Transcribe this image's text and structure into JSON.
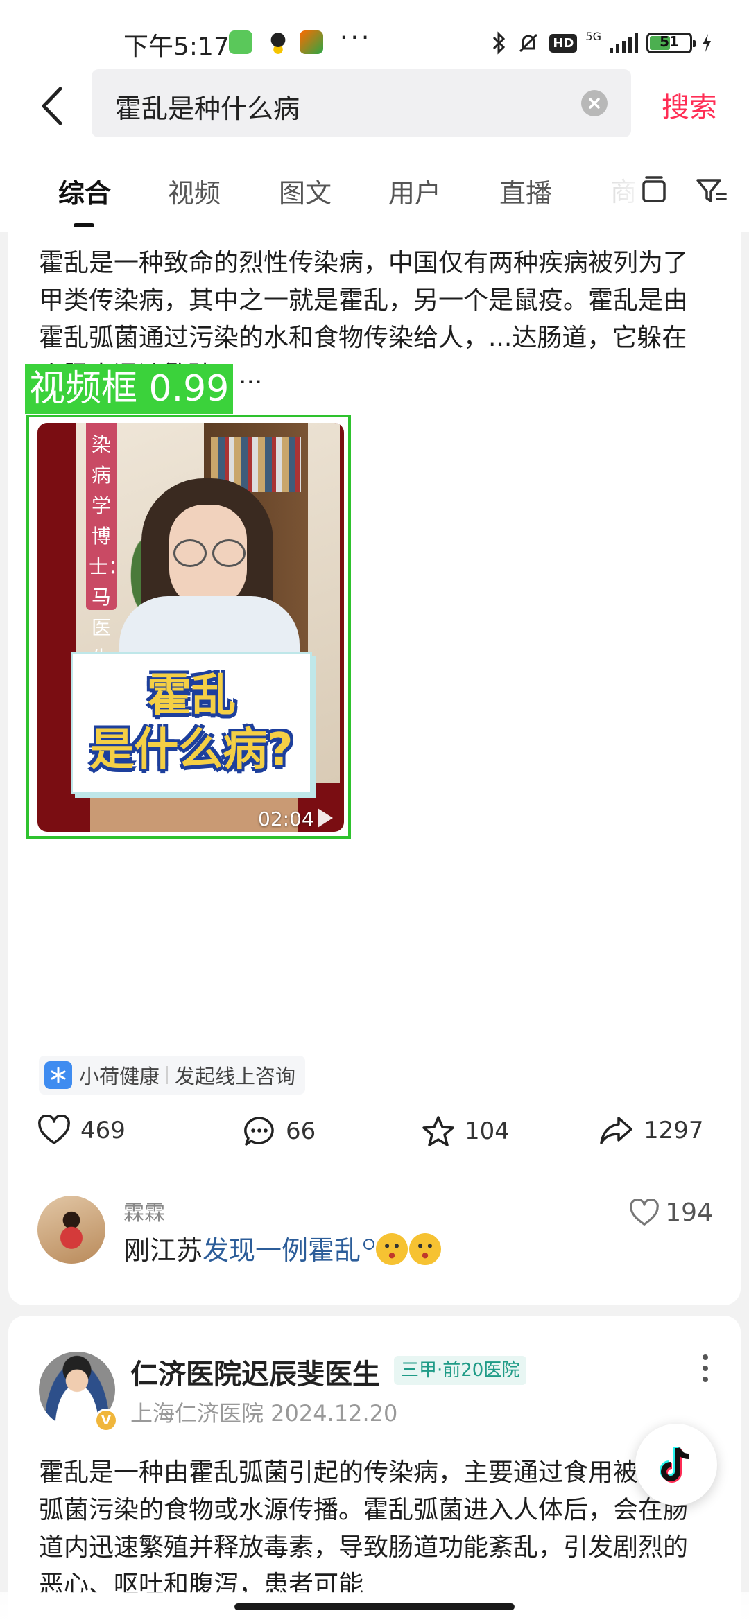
{
  "status_bar": {
    "time": "下午5:17",
    "network": "5G",
    "hd": "HD",
    "battery": "51"
  },
  "search": {
    "query": "霍乱是种什么病",
    "search_label": "搜索"
  },
  "tabs": [
    {
      "label": "综合",
      "active": true
    },
    {
      "label": "视频"
    },
    {
      "label": "图文"
    },
    {
      "label": "用户"
    },
    {
      "label": "直播"
    },
    {
      "label": "商"
    }
  ],
  "post1": {
    "text": "霍乱是一种致命的烈性传染病，中国仅有两种疾病被列为了甲类传染病，其中之一就是霍乱，另一个是鼠疫。霍乱是由霍乱弧菌通过污染的水和食物传染给人，...达肠道，它躲在小肠中迅速繁殖，...",
    "detection_label": "视频框 0.99",
    "video": {
      "side_caption": "染病学博士：马医生",
      "title_line1": "霍乱",
      "title_line2": "是什么病?",
      "duration": "02:04"
    },
    "source": {
      "name": "小荷健康",
      "action": "发起线上咨询"
    },
    "stats": {
      "likes": "469",
      "comments": "66",
      "favorites": "104",
      "shares": "1297"
    },
    "comment": {
      "user": "霖霖",
      "prefix": "刚江苏",
      "link": "发现一例霍乱",
      "likes": "194"
    }
  },
  "post2": {
    "author": "仁济医院迟辰斐医生",
    "badge": "三甲·前20医院",
    "meta": "上海仁济医院 2024.12.20",
    "text": "霍乱是一种由霍乱弧菌引起的传染病，主要通过食用被霍乱弧菌污染的食物或水源传播。霍乱弧菌进入人体后，会在肠道内迅速繁殖并释放毒素，导致肠道功能紊乱，引发剧烈的恶心、呕吐和腹泻，患者可能"
  },
  "colors": {
    "accent": "#ff2e55",
    "detection": "#2ec22e",
    "link": "#2c5d99"
  }
}
